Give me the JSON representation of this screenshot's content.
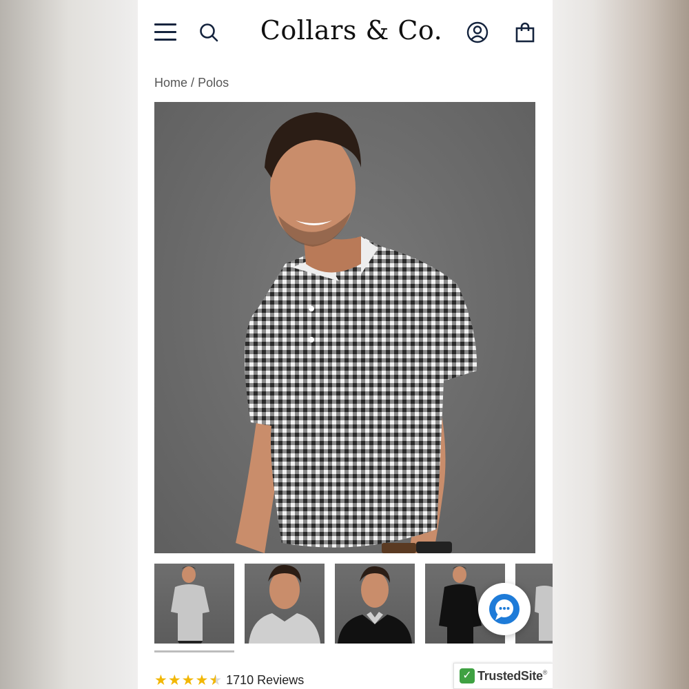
{
  "header": {
    "logo": "Collars & Co.",
    "menu_icon": "hamburger-menu-icon",
    "search_icon": "search-icon",
    "account_icon": "account-icon",
    "cart_icon": "shopping-bag-icon"
  },
  "breadcrumb": {
    "home": "Home",
    "separator": "/",
    "current": "Polos"
  },
  "product": {
    "hero_image": "man-in-gingham-polo-photo",
    "thumbnails": [
      {
        "name": "thumbnail-1",
        "image": "gingham-polo-full-body"
      },
      {
        "name": "thumbnail-2",
        "image": "gingham-polo-closeup"
      },
      {
        "name": "thumbnail-3",
        "image": "black-sweater-over-collar"
      },
      {
        "name": "thumbnail-4",
        "image": "black-sweater-full-body"
      },
      {
        "name": "thumbnail-5",
        "image": "gingham-polo-partial"
      }
    ],
    "rating": {
      "stars": 4.5,
      "reviews_label": "1710 Reviews"
    }
  },
  "chat": {
    "icon": "chat-bubble-icon"
  },
  "badge": {
    "trusted_label": "TrustedSite",
    "trusted_mark": "®",
    "check_icon": "check-icon"
  },
  "colors": {
    "navy": "#14233d",
    "star": "#f2b705",
    "chat_blue": "#1e7bd8",
    "trusted_green": "#3fa142"
  }
}
